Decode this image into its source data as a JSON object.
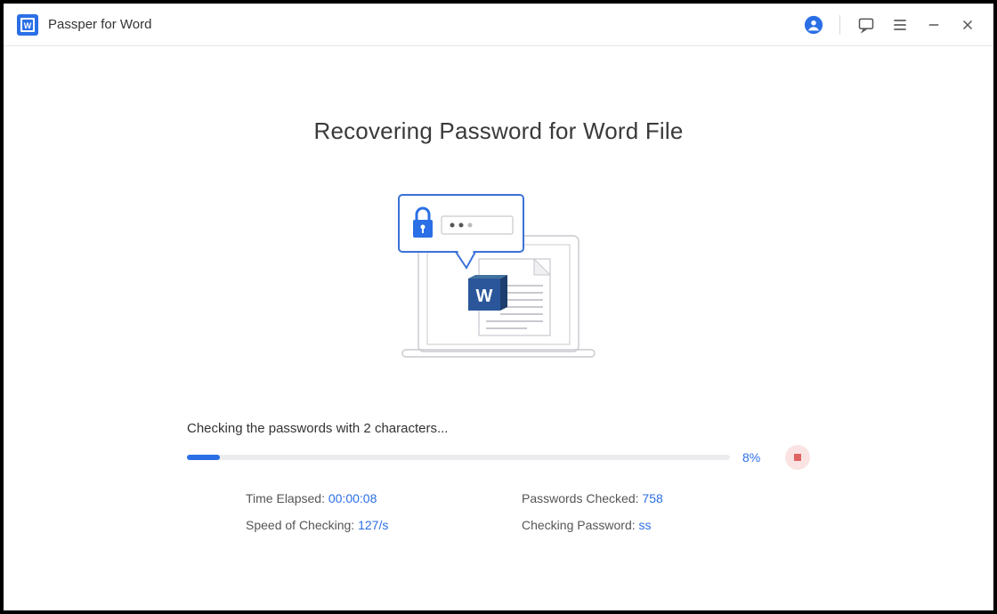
{
  "app": {
    "title": "Passper for Word"
  },
  "header": {
    "page_title": "Recovering Password for Word File"
  },
  "status": {
    "message": "Checking the passwords with 2 characters...",
    "progress_percent": "8%",
    "progress_width": "6%"
  },
  "stats": {
    "time_elapsed_label": "Time Elapsed: ",
    "time_elapsed_value": "00:00:08",
    "passwords_checked_label": "Passwords Checked: ",
    "passwords_checked_value": "758",
    "speed_label": "Speed of Checking: ",
    "speed_value": "127/s",
    "current_label": "Checking Password: ",
    "current_value": "ss"
  }
}
